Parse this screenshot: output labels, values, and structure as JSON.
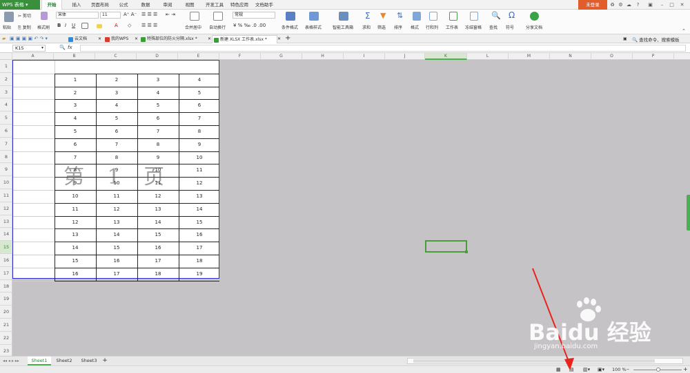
{
  "app": {
    "name": "WPS 表格",
    "login": "未登录"
  },
  "menu": [
    "开始",
    "插入",
    "页面布局",
    "公式",
    "数据",
    "审阅",
    "视图",
    "开发工具",
    "特色应用",
    "文档助手"
  ],
  "ribbon": {
    "cut": "剪切",
    "copy": "复制",
    "paste": "粘贴",
    "format_painter": "格式刷",
    "font_name": "宋体",
    "font_size": "11",
    "merge_center": "合并居中",
    "wrap_text": "自动换行",
    "number_format": "常规",
    "conditional_format": "条件格式",
    "table_style": "表格样式",
    "smart_toolbox": "智能工具箱",
    "sum": "求和",
    "filter": "筛选",
    "sort": "排序",
    "format": "格式",
    "rows_cols": "行和列",
    "worksheet": "工作表",
    "freeze": "冻结窗格",
    "find": "查找",
    "symbol": "符号",
    "share": "分享文档"
  },
  "doc_tabs": [
    "云文档",
    "我的WPS",
    "特殊部位的防火分隔.xlsx *",
    "新建 XLSX 工作表.xlsx *"
  ],
  "search_hint": "查找命令、搜索模板",
  "namebox": "K15",
  "fx": "fx",
  "columns": [
    "A",
    "B",
    "C",
    "D",
    "E",
    "F",
    "G",
    "H",
    "I",
    "J",
    "K",
    "L",
    "M",
    "N",
    "O",
    "P"
  ],
  "rows": [
    "1",
    "2",
    "3",
    "4",
    "5",
    "6",
    "7",
    "8",
    "9",
    "10",
    "11",
    "12",
    "13",
    "14",
    "15",
    "16",
    "17",
    "18",
    "19",
    "20",
    "21",
    "22",
    "23",
    "24"
  ],
  "table": [
    [
      "1",
      "2",
      "3",
      "4"
    ],
    [
      "2",
      "3",
      "4",
      "5"
    ],
    [
      "3",
      "4",
      "5",
      "6"
    ],
    [
      "4",
      "5",
      "6",
      "7"
    ],
    [
      "5",
      "6",
      "7",
      "8"
    ],
    [
      "6",
      "7",
      "8",
      "9"
    ],
    [
      "7",
      "8",
      "9",
      "10"
    ],
    [
      "8",
      "9",
      "10",
      "11"
    ],
    [
      "9",
      "10",
      "11",
      "12"
    ],
    [
      "10",
      "11",
      "12",
      "13"
    ],
    [
      "11",
      "12",
      "13",
      "14"
    ],
    [
      "12",
      "13",
      "14",
      "15"
    ],
    [
      "13",
      "14",
      "15",
      "16"
    ],
    [
      "14",
      "15",
      "16",
      "17"
    ],
    [
      "15",
      "16",
      "17",
      "18"
    ],
    [
      "16",
      "17",
      "18",
      "19"
    ]
  ],
  "watermark": "第 1 页",
  "sheets": [
    "Sheet1",
    "Sheet2",
    "Sheet3"
  ],
  "zoom": "100 %",
  "baidu": {
    "brand": "Baidu 经验",
    "url": "jingyan.baidu.com"
  },
  "colors": {
    "accent": "#3a8f3d",
    "print_border": "#2b2bcf",
    "selection": "#4a9c3a",
    "arrow": "#e8231c"
  }
}
